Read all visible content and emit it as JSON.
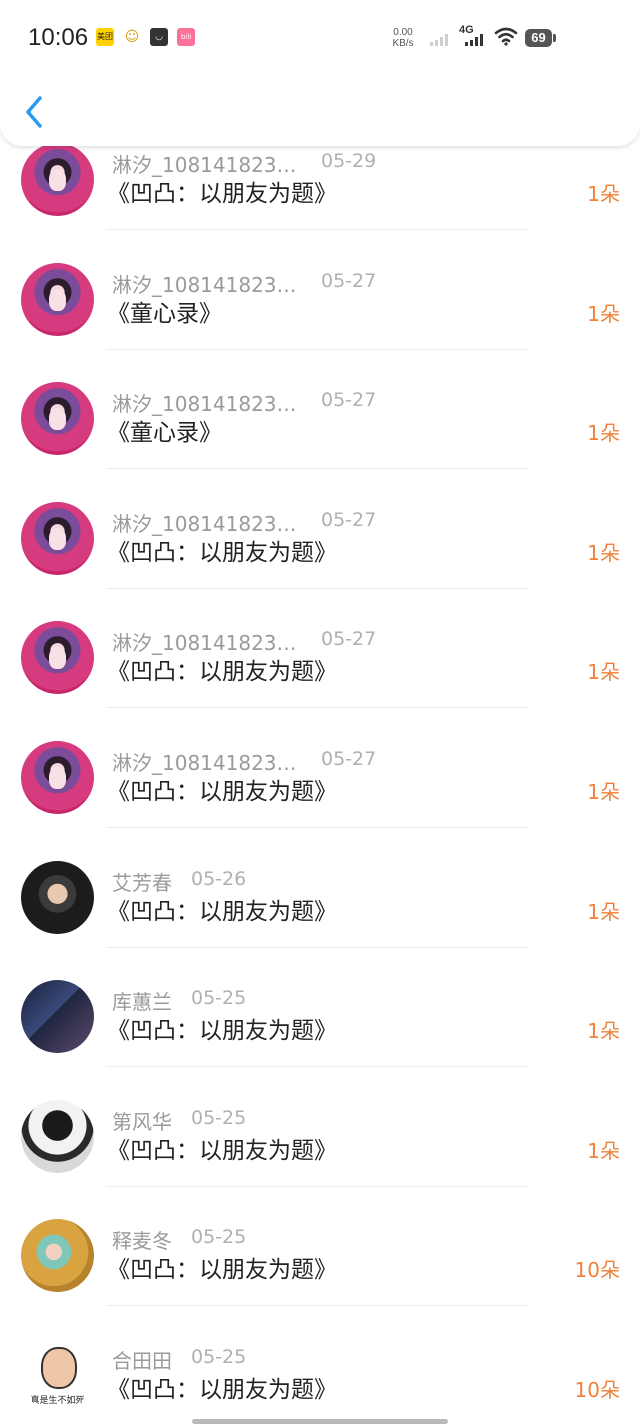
{
  "status_bar": {
    "time": "10:06",
    "net_speed_value": "0.00",
    "net_speed_unit": "KB/s",
    "network_type": "4G",
    "battery": "69",
    "app_icons": [
      "meituan-icon",
      "smile-icon",
      "bag-icon",
      "bilibili-icon"
    ]
  },
  "header": {
    "back_icon": "chevron-left-icon",
    "accent": "#2a9cf0"
  },
  "colors": {
    "count": "#f0803a",
    "name": "#9a9a9a",
    "title": "#222222"
  },
  "items": [
    {
      "name": "淋汐_108141823…",
      "date": "05-29",
      "title": "《凹凸：以朋友为题》",
      "count": "1朵",
      "avatar": "anime-girl-avatar"
    },
    {
      "name": "淋汐_108141823…",
      "date": "05-27",
      "title": "《童心录》",
      "count": "1朵",
      "avatar": "anime-girl-avatar"
    },
    {
      "name": "淋汐_108141823…",
      "date": "05-27",
      "title": "《童心录》",
      "count": "1朵",
      "avatar": "anime-girl-avatar"
    },
    {
      "name": "淋汐_108141823…",
      "date": "05-27",
      "title": "《凹凸：以朋友为题》",
      "count": "1朵",
      "avatar": "anime-girl-avatar"
    },
    {
      "name": "淋汐_108141823…",
      "date": "05-27",
      "title": "《凹凸：以朋友为题》",
      "count": "1朵",
      "avatar": "anime-girl-avatar"
    },
    {
      "name": "淋汐_108141823…",
      "date": "05-27",
      "title": "《凹凸：以朋友为题》",
      "count": "1朵",
      "avatar": "anime-girl-avatar"
    },
    {
      "name": "艾芳春",
      "date": "05-26",
      "title": "《凹凸：以朋友为题》",
      "count": "1朵",
      "avatar": "cartoon-kid-avatar"
    },
    {
      "name": "库蕙兰",
      "date": "05-25",
      "title": "《凹凸：以朋友为题》",
      "count": "1朵",
      "avatar": "couple-photo-avatar"
    },
    {
      "name": "第风华",
      "date": "05-25",
      "title": "《凹凸：以朋友为题》",
      "count": "1朵",
      "avatar": "hooded-person-avatar"
    },
    {
      "name": "释麦冬",
      "date": "05-25",
      "title": "《凹凸：以朋友为题》",
      "count": "10朵",
      "avatar": "girl-photo-avatar"
    },
    {
      "name": "合田田",
      "date": "05-25",
      "title": "《凹凸：以朋友为题》",
      "count": "10朵",
      "avatar": "meme-face-avatar",
      "avatar_caption": "真是生不如死"
    }
  ]
}
